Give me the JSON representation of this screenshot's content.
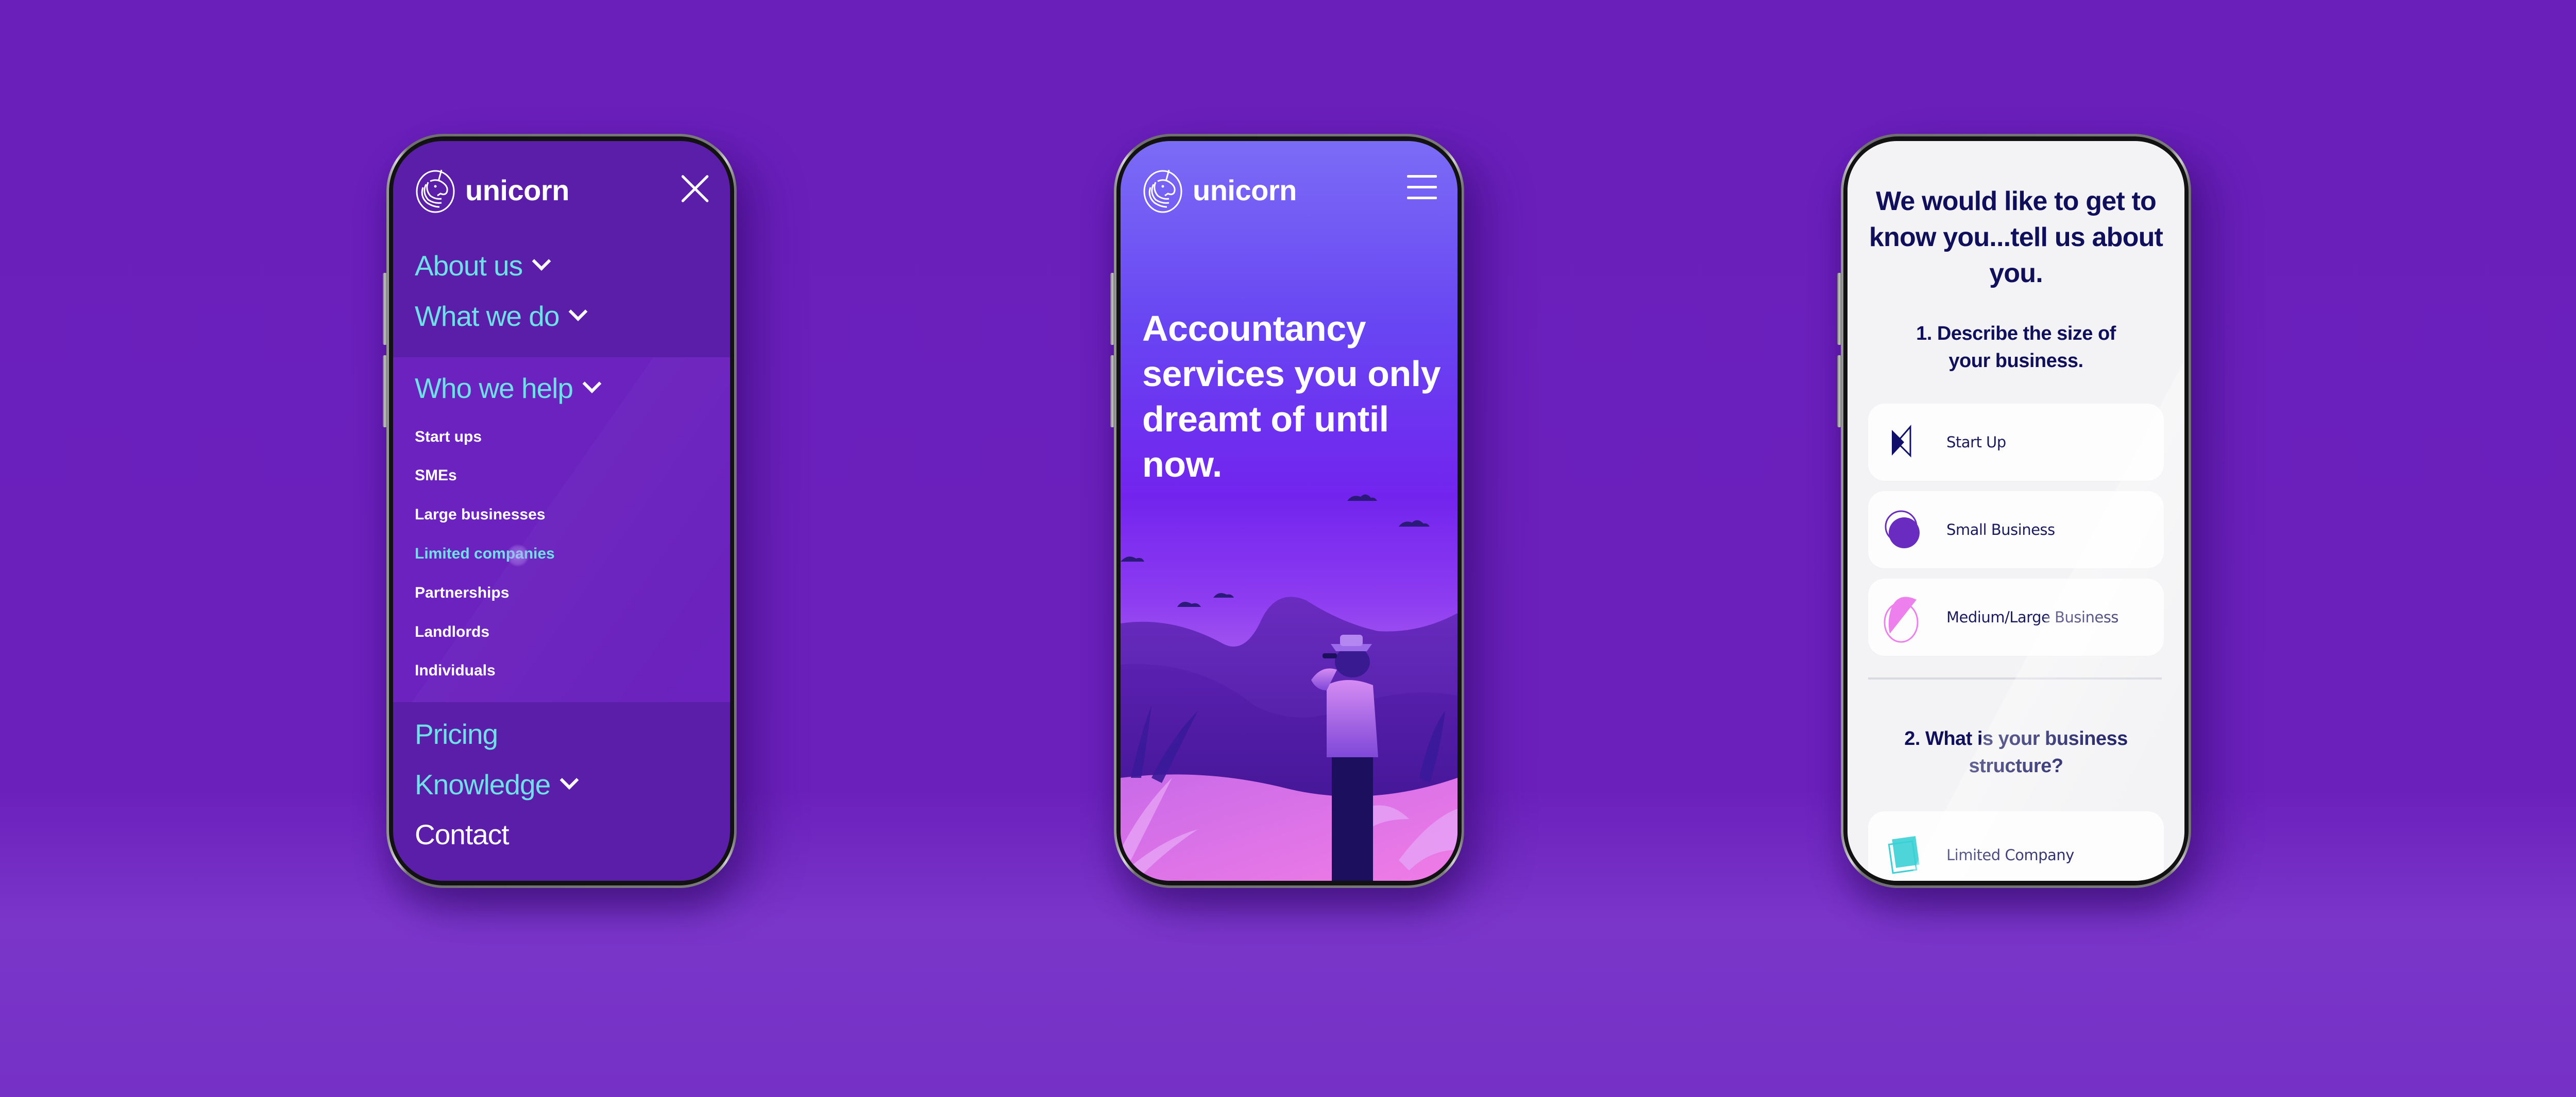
{
  "background": {
    "color_top": "#6a1fbb",
    "color_bottom": "#7a35c9"
  },
  "brand": {
    "name": "unicorn",
    "accent_cyan": "#6fe0e6",
    "menu_bg": "#5b1ea8",
    "menu_expanded_bg": "#6b22be",
    "navy_text": "#0f0f5c"
  },
  "phone_menu": {
    "logo_text": "unicorn",
    "close_icon": "close-icon",
    "nav": [
      {
        "label": "About us",
        "has_dropdown": true
      },
      {
        "label": "What we do",
        "has_dropdown": true
      },
      {
        "label": "Who we help",
        "has_dropdown": true,
        "expanded": true
      },
      {
        "label": "Pricing",
        "has_dropdown": false
      },
      {
        "label": "Knowledge",
        "has_dropdown": true
      },
      {
        "label": "Contact",
        "has_dropdown": false
      }
    ],
    "who_we_help_items": [
      {
        "label": "Start ups",
        "active": false
      },
      {
        "label": "SMEs",
        "active": false
      },
      {
        "label": "Large businesses",
        "active": false
      },
      {
        "label": "Limited companies",
        "active": true
      },
      {
        "label": "Partnerships",
        "active": false
      },
      {
        "label": "Landlords",
        "active": false
      },
      {
        "label": "Individuals",
        "active": false
      }
    ]
  },
  "phone_hero": {
    "logo_text": "unicorn",
    "menu_icon": "hamburger-icon",
    "headline": "Accountancy services you only dreamt of until now.",
    "illustration": "person-with-binoculars-watching-unicorns"
  },
  "phone_form": {
    "title": "We would like to get to know you...tell us about you.",
    "question_1": "1. Describe the size of your business.",
    "size_options": [
      {
        "label": "Start Up",
        "icon": "bowtie-triangle-icon"
      },
      {
        "label": "Small Business",
        "icon": "overlapping-circles-icon"
      },
      {
        "label": "Medium/Large Business",
        "icon": "half-circle-icon"
      }
    ],
    "question_2": "2. What is your business structure?",
    "structure_options": [
      {
        "label": "Limited Company",
        "icon": "stacked-squares-icon"
      }
    ]
  }
}
